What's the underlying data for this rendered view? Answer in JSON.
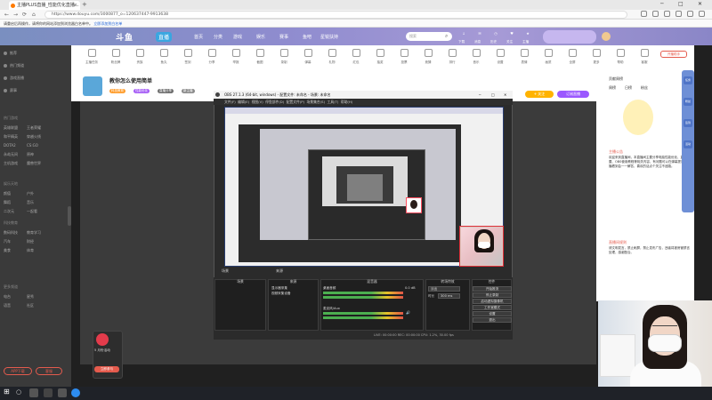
{
  "browser": {
    "tab_title": "主播PLUS直播_性能优化直播...",
    "new_tab": "+",
    "url": "https://www.douyu.com/3000877_o=120637447-9913638",
    "back": "←",
    "forward": "→",
    "reload": "⟳",
    "home": "⌂",
    "win_minimize": "─",
    "win_maximize": "□",
    "win_close": "✕"
  },
  "bookmark_bar": {
    "notice": "请重启后再操作，请将你的网站添加到浏览器白名单中。",
    "link": "立即添加到白名单"
  },
  "site_header": {
    "logo": "斗鱼",
    "logo_badge": "直播",
    "nav": [
      "首页",
      "分类",
      "游戏",
      "娱乐",
      "赛事",
      "鱼吧",
      "星锐扶持"
    ],
    "search_placeholder": "搜索",
    "search_icon": "search-icon",
    "user_icons": [
      "下载",
      "消息",
      "历史",
      "关注",
      "主播"
    ]
  },
  "sidebar": {
    "top_items": [
      "推荐",
      "热门频道",
      "游戏直播",
      "赛事"
    ],
    "sections": [
      {
        "title": "热门游戏",
        "items": [
          "英雄联盟",
          "王者荣耀",
          "和平精英",
          "穿越火线",
          "DOTA2",
          "CS:GO",
          "永劫无间",
          "原神",
          "主机游戏",
          "魔兽世界"
        ]
      },
      {
        "title": "娱乐天地",
        "items": [
          "颜值",
          "户外",
          "舞蹈",
          "音乐",
          "二次元",
          "一起看"
        ]
      },
      {
        "title": "科技教育",
        "items": [
          "数码科技",
          "教育学习",
          "汽车",
          "财经",
          "美食",
          "体育"
        ]
      },
      {
        "title": "更多频道",
        "items": [
          "电台",
          "星秀",
          "语音",
          "社区"
        ]
      }
    ],
    "bottom_buttons": [
      "APP下载",
      "客服"
    ]
  },
  "gift_bar": {
    "items": [
      "主播任务",
      "粉丝牌",
      "贵族",
      "鱼丸",
      "签到",
      "分享",
      "举报",
      "截图",
      "录制",
      "弹幕",
      "礼物",
      "红包",
      "抽奖",
      "投票",
      "竞猜",
      "排行",
      "音乐",
      "设置",
      "表情",
      "画质",
      "全屏",
      "更多",
      "帮助",
      "客服"
    ],
    "right_label": "开播助手"
  },
  "stream_info": {
    "title": "教你怎么使用简单",
    "tags": [
      "科技教育",
      "性能优化",
      "直播分享",
      "新主播"
    ],
    "follow_label": "+ 关注",
    "sub_label": "订阅直播"
  },
  "obs": {
    "title": "OBS 27.1.3 (64-bit, windows) - 配置文件: 未命名 - 场景: 未命名",
    "menu": [
      "文件(F)",
      "编辑(E)",
      "视图(V)",
      "停靠部件(D)",
      "配置文件(P)",
      "场景集合(S)",
      "工具(T)",
      "帮助(H)"
    ],
    "scene_bar": [
      "场景",
      "来源",
      "混音器",
      "转场特效",
      "控件"
    ],
    "sources": [
      "显示器采集",
      "视频采集设备"
    ],
    "mixer": [
      "桌面音频",
      "麦克风/Aux"
    ],
    "meter_value": "0.0 dB",
    "transition": "淡出",
    "duration_label": "时长",
    "duration": "300 ms",
    "controls": [
      "开始推流",
      "停止录制",
      "启动虚拟摄像机",
      "工作室模式",
      "设置",
      "退出"
    ],
    "status": "LIVE: 00:00:00   REC: 00:00:00   CPU: 1.2%, 30.00 fps",
    "win_minimize": "─",
    "win_maximize": "□",
    "win_close": "✕"
  },
  "right_panel": {
    "header": "贡献周榜",
    "rank_tabs": [
      "周榜",
      "日榜",
      "粉丝"
    ],
    "notice_title": "主播公告",
    "notice_text": "欢迎来到直播间，本直播间主要分享电脑性能优化、直播设置、OBS使用教程等相关内容，有问题可以在弹幕提问，主播看到会一一解答，喜欢的话点个关注不迷路。",
    "section2_title": "直播间规则",
    "section2_text": "请文明发言，禁止刷屏，禁止发布广告，违者将被房管禁言处理，感谢配合。",
    "float_buttons": [
      "任务",
      "粉丝",
      "签到",
      "活动"
    ]
  },
  "float_widget": {
    "label": "5 月份活动",
    "button": "立即参与"
  },
  "taskbar": {
    "start": "⊞",
    "search": "○"
  }
}
